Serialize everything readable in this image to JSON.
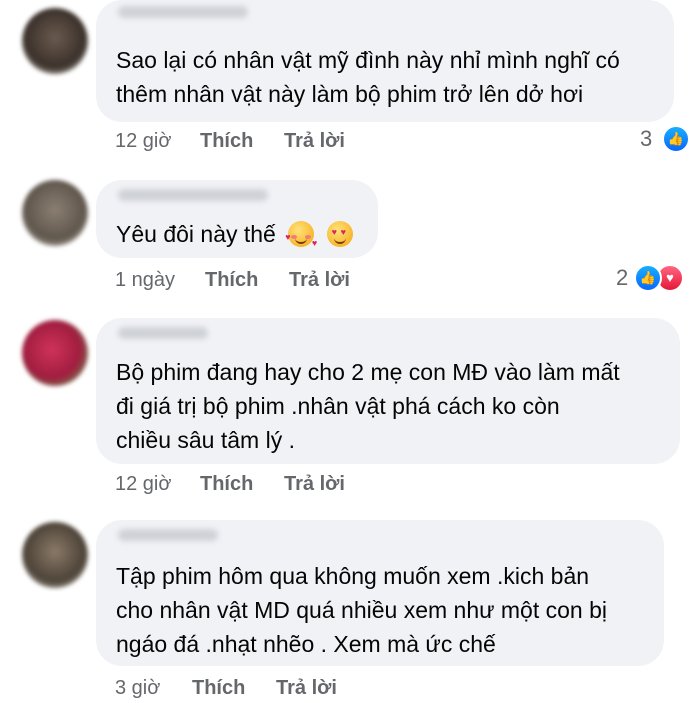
{
  "colors": {
    "bubble": "#f0f2f5",
    "text": "#050505",
    "meta": "#65676b",
    "like": "#0866ff",
    "love": "#e61739"
  },
  "comments": [
    {
      "lines": [
        "Sao lại có nhân vật mỹ đình này nhỉ mình nghĩ có",
        "thêm nhân vật này làm bộ phim trở lên dở hơi"
      ],
      "time": "12 giờ",
      "like": "Thích",
      "reply": "Trả lời",
      "reaction_count": "3",
      "reaction_icons": [
        "like-icon"
      ]
    },
    {
      "lines": [
        "Yêu đôi này thế"
      ],
      "emojis": [
        "smiling-face-with-hearts-icon",
        "heart-eyes-icon"
      ],
      "time": "1 ngày",
      "like": "Thích",
      "reply": "Trả lời",
      "reaction_count": "2",
      "reaction_icons": [
        "like-icon",
        "love-icon"
      ]
    },
    {
      "lines": [
        "Bộ phim đang hay cho 2 mẹ con MĐ vào làm mất",
        "đi giá trị bộ phim .nhân vật phá cách ko còn",
        "chiều sâu tâm lý ."
      ],
      "time": "12 giờ",
      "like": "Thích",
      "reply": "Trả lời"
    },
    {
      "lines": [
        "Tập phim hôm qua không muốn xem .kich bản",
        "cho nhân vật MD quá nhiều xem như một con bị",
        "ngáo đá .nhạt nhẽo . Xem mà ức chế"
      ],
      "time": "3 giờ",
      "like": "Thích",
      "reply": "Trả lời"
    }
  ]
}
